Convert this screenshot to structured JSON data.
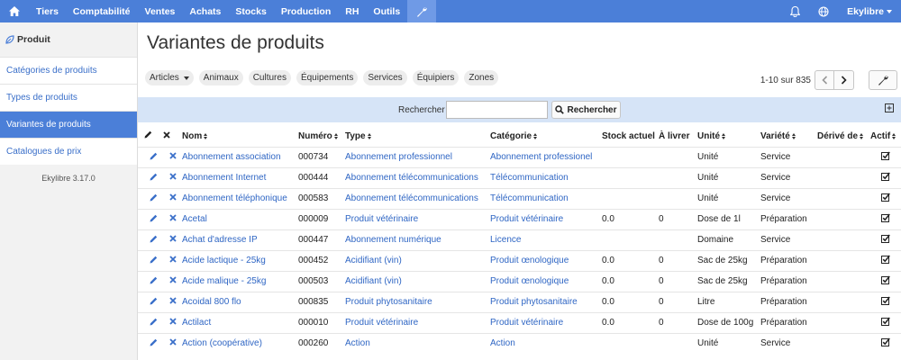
{
  "topbar": {
    "home_icon": "home-icon",
    "items": [
      "Tiers",
      "Comptabilité",
      "Ventes",
      "Achats",
      "Stocks",
      "Production",
      "RH",
      "Outils"
    ],
    "active_tool_icon": "wrench-icon",
    "user": "Ekylibre",
    "colors": {
      "bar": "#4b7fd8",
      "active": "#6f9ae6"
    }
  },
  "sidebar": {
    "title": "Produit",
    "items": [
      {
        "label": "Catégories de produits",
        "active": false
      },
      {
        "label": "Types de produits",
        "active": false
      },
      {
        "label": "Variantes de produits",
        "active": true
      },
      {
        "label": "Catalogues de prix",
        "active": false
      }
    ],
    "version": "Ekylibre 3.17.0"
  },
  "main": {
    "title": "Variantes de produits",
    "filters": [
      "Articles",
      "Animaux",
      "Cultures",
      "Équipements",
      "Services",
      "Équipiers",
      "Zones"
    ],
    "pagination": "1-10 sur 835",
    "search": {
      "label": "Rechercher",
      "value": "",
      "button": "Rechercher"
    },
    "columns": [
      "Nom",
      "Numéro",
      "Type",
      "Catégorie",
      "Stock actuel",
      "À livrer",
      "Unité",
      "Variété",
      "Dérivé de",
      "Actif"
    ],
    "rows": [
      {
        "nom": "Abonnement association",
        "numero": "000734",
        "type": "Abonnement professionnel",
        "categorie": "Abonnement professionel",
        "stock": "",
        "livrer": "",
        "unite": "Unité",
        "variete": "Service",
        "derive": ""
      },
      {
        "nom": "Abonnement Internet",
        "numero": "000444",
        "type": "Abonnement télécommunications",
        "categorie": "Télécommunication",
        "stock": "",
        "livrer": "",
        "unite": "Unité",
        "variete": "Service",
        "derive": ""
      },
      {
        "nom": "Abonnement téléphonique",
        "numero": "000583",
        "type": "Abonnement télécommunications",
        "categorie": "Télécommunication",
        "stock": "",
        "livrer": "",
        "unite": "Unité",
        "variete": "Service",
        "derive": ""
      },
      {
        "nom": "Acetal",
        "numero": "000009",
        "type": "Produit vétérinaire",
        "categorie": "Produit vétérinaire",
        "stock": "0.0",
        "livrer": "0",
        "unite": "Dose de 1l",
        "variete": "Préparation",
        "derive": ""
      },
      {
        "nom": "Achat d'adresse IP",
        "numero": "000447",
        "type": "Abonnement numérique",
        "categorie": "Licence",
        "stock": "",
        "livrer": "",
        "unite": "Domaine",
        "variete": "Service",
        "derive": ""
      },
      {
        "nom": "Acide lactique - 25kg",
        "numero": "000452",
        "type": "Acidifiant (vin)",
        "categorie": "Produit œnologique",
        "stock": "0.0",
        "livrer": "0",
        "unite": "Sac de 25kg",
        "variete": "Préparation",
        "derive": ""
      },
      {
        "nom": "Acide malique - 25kg",
        "numero": "000503",
        "type": "Acidifiant (vin)",
        "categorie": "Produit œnologique",
        "stock": "0.0",
        "livrer": "0",
        "unite": "Sac de 25kg",
        "variete": "Préparation",
        "derive": ""
      },
      {
        "nom": "Acoidal 800 flo",
        "numero": "000835",
        "type": "Produit phytosanitaire",
        "categorie": "Produit phytosanitaire",
        "stock": "0.0",
        "livrer": "0",
        "unite": "Litre",
        "variete": "Préparation",
        "derive": ""
      },
      {
        "nom": "Actilact",
        "numero": "000010",
        "type": "Produit vétérinaire",
        "categorie": "Produit vétérinaire",
        "stock": "0.0",
        "livrer": "0",
        "unite": "Dose de 100g",
        "variete": "Préparation",
        "derive": ""
      },
      {
        "nom": "Action (coopérative)",
        "numero": "000260",
        "type": "Action",
        "categorie": "Action",
        "stock": "",
        "livrer": "",
        "unite": "Unité",
        "variete": "Service",
        "derive": ""
      }
    ]
  }
}
